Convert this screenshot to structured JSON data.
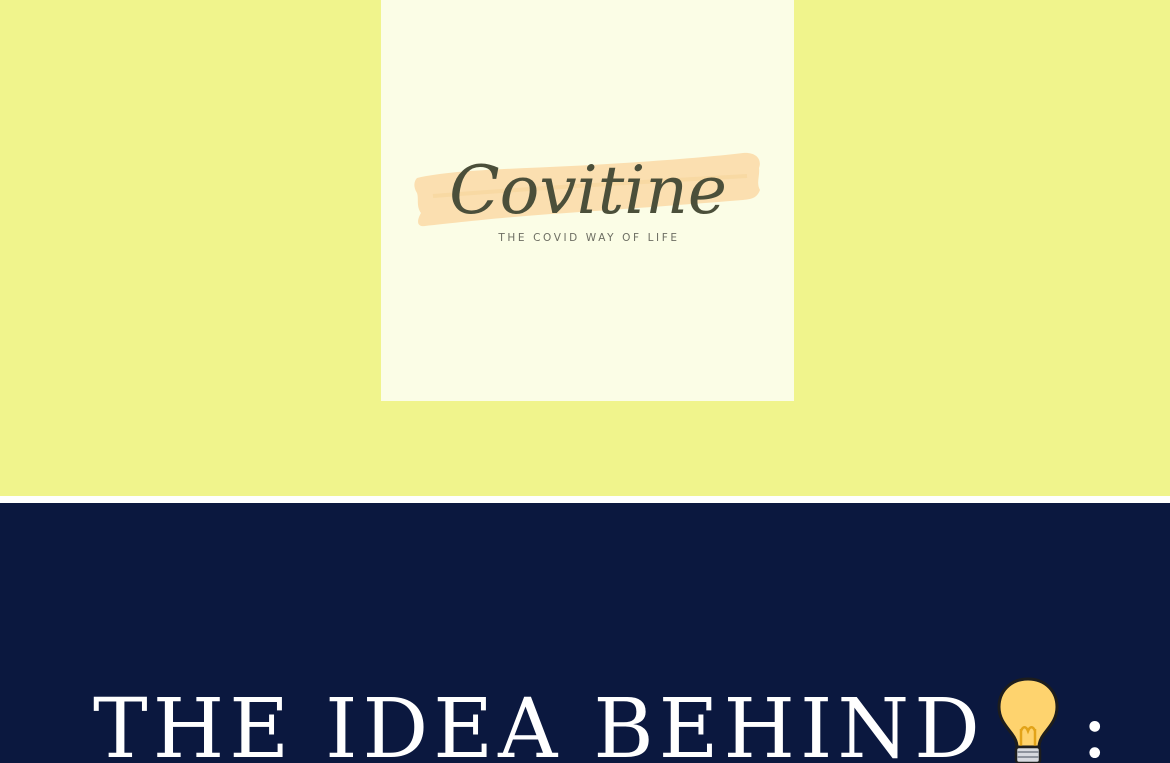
{
  "logo": {
    "wordmark": "Covitine",
    "tagline": "THE COVID WAY OF LIFE"
  },
  "idea_section": {
    "heading": "THE IDEA BEHIND",
    "heading_icon": "lightbulb-icon",
    "heading_suffix": ":"
  },
  "colors": {
    "hero_background": "#f0f48c",
    "logo_card_background": "#fbfde6",
    "brush_stroke": "#fbdfb0",
    "wordmark_text": "#4b4f3a",
    "idea_background": "#0b183f",
    "heading_text": "#ffffff",
    "bulb_glass": "#fed36e"
  }
}
